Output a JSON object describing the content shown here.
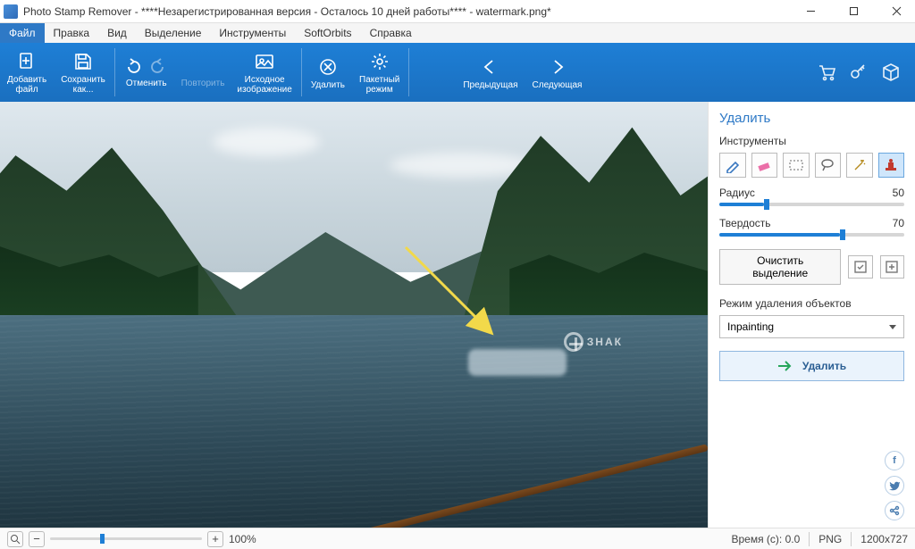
{
  "titlebar": {
    "title": "Photo Stamp Remover - ****Незарегистрированная версия - Осталось 10 дней работы**** - watermark.png*"
  },
  "menu": {
    "items": [
      "Файл",
      "Правка",
      "Вид",
      "Выделение",
      "Инструменты",
      "SoftOrbits",
      "Справка"
    ],
    "active_index": 0
  },
  "ribbon": {
    "add_file": "Добавить\nфайл",
    "save_as": "Сохранить\nкак...",
    "undo": "Отменить",
    "redo": "Повторить",
    "original": "Исходное\nизображение",
    "delete": "Удалить",
    "batch": "Пакетный\nрежим",
    "prev": "Предыдущая",
    "next": "Следующая"
  },
  "panel": {
    "title": "Удалить",
    "tools_label": "Инструменты",
    "radius_label": "Радиус",
    "radius_value": "50",
    "radius_pct": 24,
    "hardness_label": "Твердость",
    "hardness_value": "70",
    "hardness_pct": 65,
    "clear_selection": "Очистить выделение",
    "mode_label": "Режим удаления объектов",
    "mode_value": "Inpainting",
    "action": "Удалить"
  },
  "watermark_text": "ЗНАК",
  "status": {
    "zoom_pct": 33,
    "zoom_label": "100%",
    "time_label": "Время (с): 0.0",
    "format": "PNG",
    "dimensions": "1200x727"
  },
  "icons": {
    "add": "add-file-icon",
    "save": "save-icon",
    "undo": "undo-icon",
    "redo": "redo-icon",
    "original": "original-image-icon",
    "delete": "delete-icon",
    "batch": "gear-icon",
    "prev": "arrow-left-icon",
    "next": "arrow-right-icon",
    "cart": "cart-icon",
    "key": "key-icon",
    "cube": "cube-icon"
  }
}
